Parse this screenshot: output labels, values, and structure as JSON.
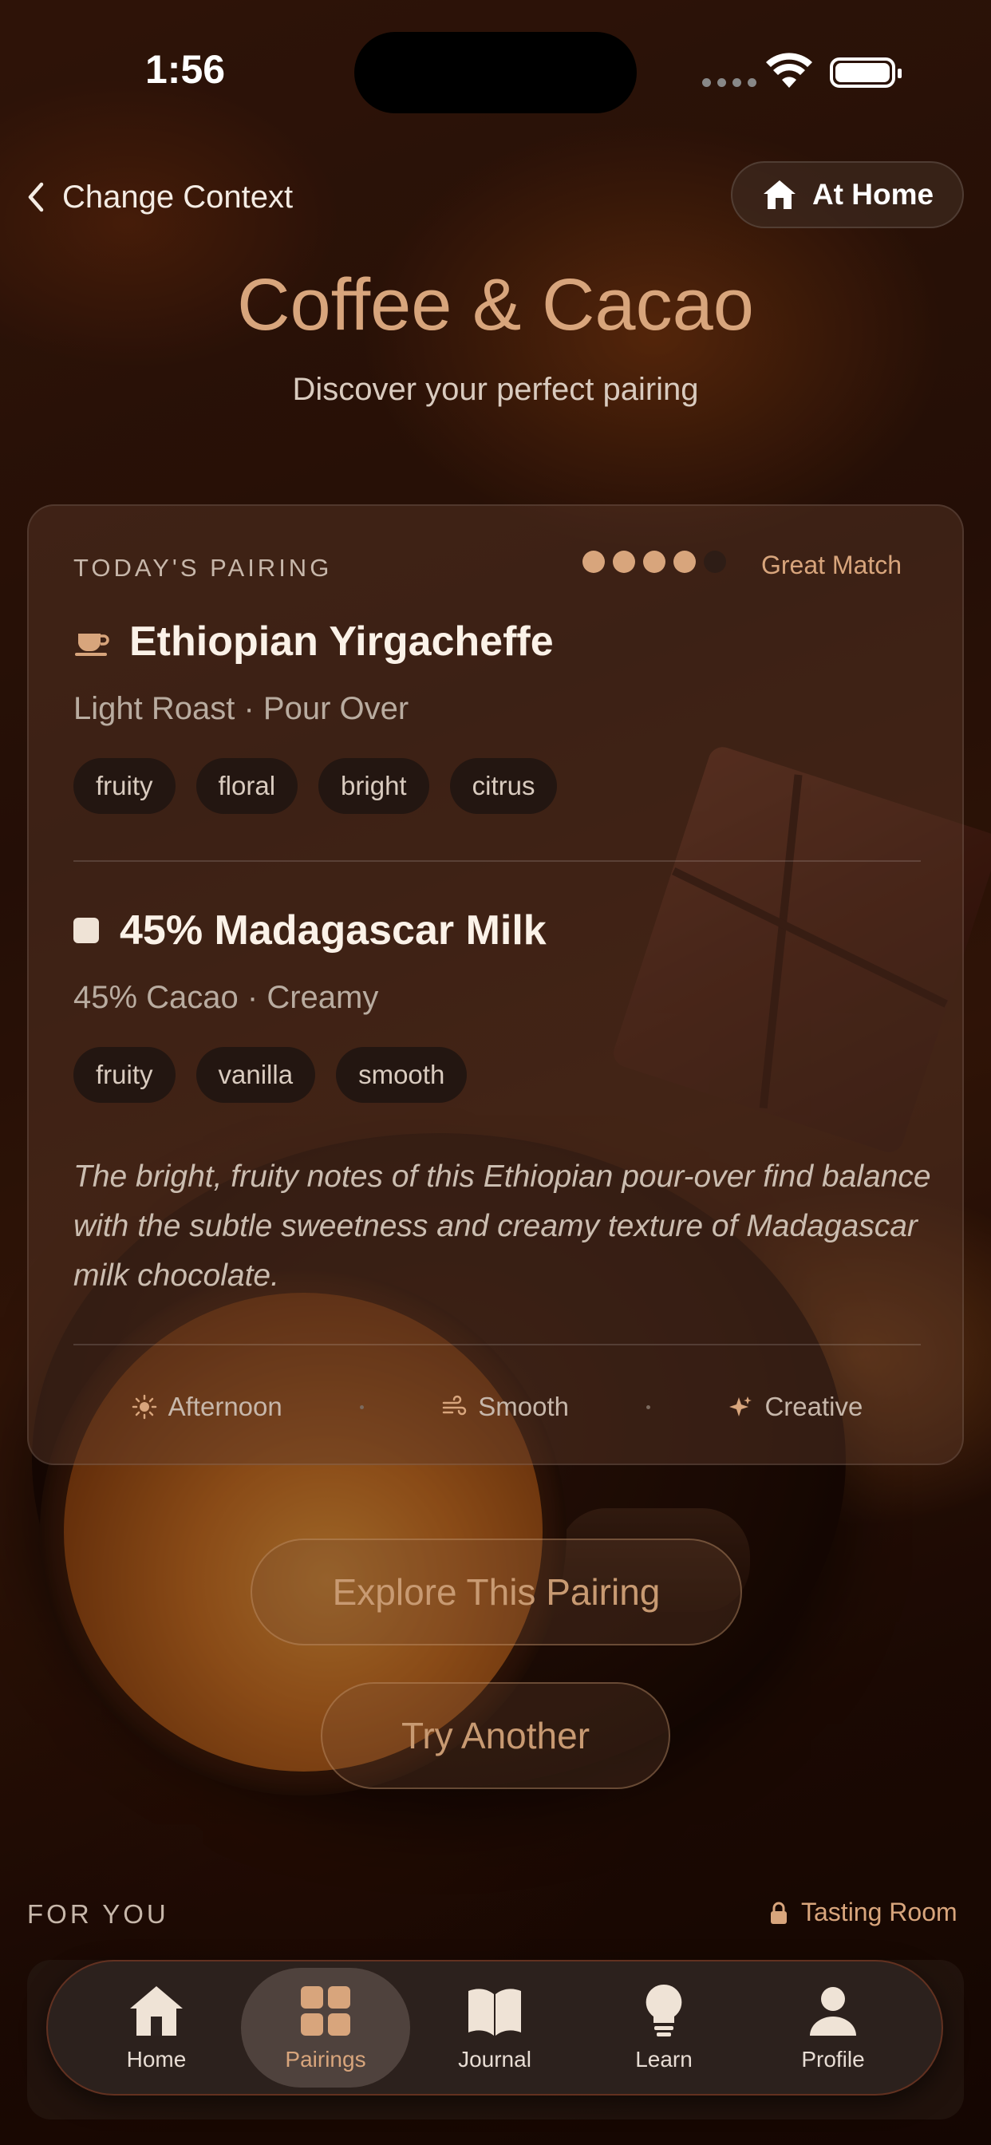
{
  "status_bar": {
    "time": "1:56"
  },
  "nav": {
    "back_label": "Change Context",
    "context_label": "At Home"
  },
  "header": {
    "title": "Coffee & Cacao",
    "subtitle": "Discover your perfect pairing"
  },
  "pairing": {
    "section_label": "TODAY'S PAIRING",
    "rating": 4,
    "rating_max": 5,
    "match_label": "Great Match",
    "coffee": {
      "name": "Ethiopian Yirgacheffe",
      "details": "Light Roast · Pour Over",
      "tags": [
        "fruity",
        "floral",
        "bright",
        "citrus"
      ]
    },
    "chocolate": {
      "name": "45% Madagascar Milk",
      "details": "45% Cacao · Creamy",
      "tags": [
        "fruity",
        "vanilla",
        "smooth"
      ]
    },
    "description": "The bright, fruity notes of this Ethiopian pour-over find balance with the subtle sweetness and creamy texture of Madagascar milk chocolate.",
    "moods": [
      {
        "icon": "sun-icon",
        "label": "Afternoon"
      },
      {
        "icon": "wind-icon",
        "label": "Smooth"
      },
      {
        "icon": "sparkle-icon",
        "label": "Creative"
      }
    ]
  },
  "actions": {
    "explore_label": "Explore This Pairing",
    "another_label": "Try Another"
  },
  "for_you": {
    "section_label": "FOR YOU",
    "tasting_room_label": "Tasting Room"
  },
  "tabbar": {
    "items": [
      {
        "label": "Home",
        "icon": "house-icon"
      },
      {
        "label": "Pairings",
        "icon": "grid-icon",
        "active": true
      },
      {
        "label": "Journal",
        "icon": "book-icon"
      },
      {
        "label": "Learn",
        "icon": "lightbulb-icon"
      },
      {
        "label": "Profile",
        "icon": "person-icon"
      }
    ]
  },
  "colors": {
    "accent": "#d8a57c",
    "card_bg": "#5f3c2a",
    "tag_bg": "#1e1410"
  }
}
